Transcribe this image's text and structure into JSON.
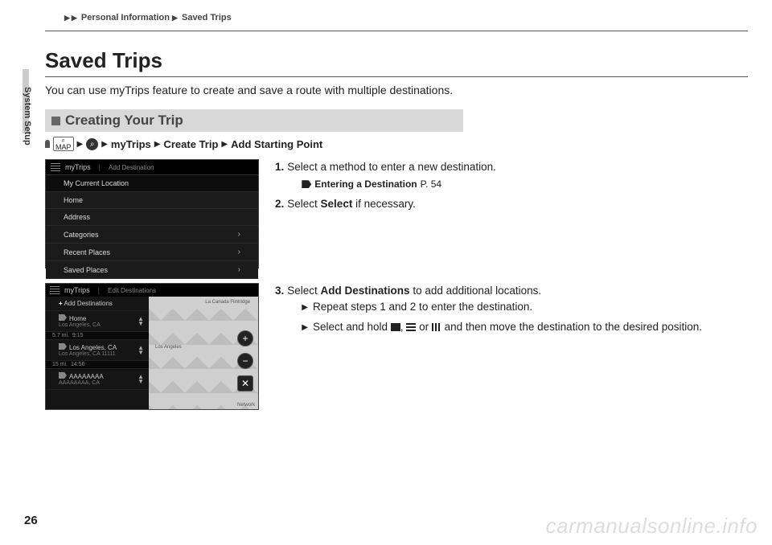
{
  "breadcrumb": {
    "item1": "Personal Information",
    "item2": "Saved Trips"
  },
  "sideLabel": "System Setup",
  "title": "Saved Trips",
  "intro": "You can use myTrips feature to create and save a route with multiple destinations.",
  "section": {
    "heading": "Creating Your Trip",
    "pathMapLabel": "MAP",
    "pathSearchIcon": "⌕",
    "path1": "myTrips",
    "path2": "Create Trip",
    "path3": "Add Starting Point"
  },
  "ss1": {
    "tab1": "myTrips",
    "tab2": "Add Destination",
    "rows": {
      "r1": "My Current Location",
      "r2": "Home",
      "r3": "Address",
      "r4": "Categories",
      "r5": "Recent Places",
      "r6": "Saved Places"
    }
  },
  "steps1": {
    "s1num": "1.",
    "s1": "Select a method to enter a new destination.",
    "xref": "Entering a Destination",
    "xrefPage": "P. 54",
    "s2num": "2.",
    "s2a": "Select ",
    "s2b": "Select",
    "s2c": " if necessary."
  },
  "ss2": {
    "tab1": "myTrips",
    "tab2": "Edit Destinations",
    "addDest": "Add Destinations",
    "home": "Home",
    "homeSub": "Los Angeles, CA",
    "d1": "5.7 mi.",
    "t1": "9:15",
    "la": "Los Angeles, CA",
    "laSub": "Los Angeles, CA 11111",
    "d2": "15 mi.",
    "t2": "14:56",
    "aa": "AAAAAAAA",
    "aaSub": "AAAAAAAA, CA",
    "mapLabelCanada": "La Canada Flintridge",
    "mapLabelLA": "Los Angeles",
    "mapLabelNetwork": "Network"
  },
  "steps2": {
    "s3num": "3.",
    "s3a": "Select ",
    "s3b": "Add Destinations",
    "s3c": " to add additional locations.",
    "b1": "Repeat steps 1 and 2 to enter the destination.",
    "b2a": "Select and hold ",
    "b2b": ", ",
    "b2c": " or ",
    "b2d": " and then move the destination to the desired position."
  },
  "pageNum": "26",
  "watermark": "carmanualsonline.info"
}
